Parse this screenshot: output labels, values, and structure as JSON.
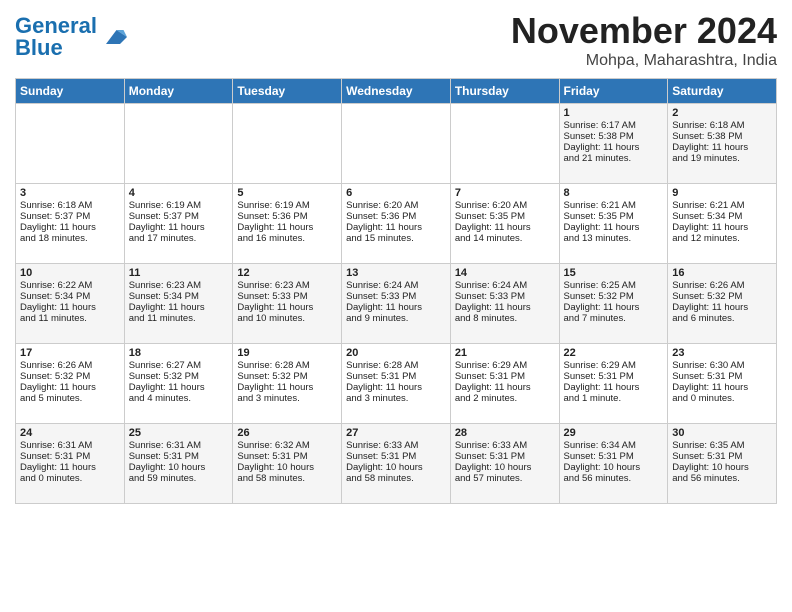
{
  "header": {
    "logo_general": "General",
    "logo_blue": "Blue",
    "month_title": "November 2024",
    "location": "Mohpa, Maharashtra, India"
  },
  "days_of_week": [
    "Sunday",
    "Monday",
    "Tuesday",
    "Wednesday",
    "Thursday",
    "Friday",
    "Saturday"
  ],
  "weeks": [
    [
      {
        "day": "",
        "info": ""
      },
      {
        "day": "",
        "info": ""
      },
      {
        "day": "",
        "info": ""
      },
      {
        "day": "",
        "info": ""
      },
      {
        "day": "",
        "info": ""
      },
      {
        "day": "1",
        "info": "Sunrise: 6:17 AM\nSunset: 5:38 PM\nDaylight: 11 hours\nand 21 minutes."
      },
      {
        "day": "2",
        "info": "Sunrise: 6:18 AM\nSunset: 5:38 PM\nDaylight: 11 hours\nand 19 minutes."
      }
    ],
    [
      {
        "day": "3",
        "info": "Sunrise: 6:18 AM\nSunset: 5:37 PM\nDaylight: 11 hours\nand 18 minutes."
      },
      {
        "day": "4",
        "info": "Sunrise: 6:19 AM\nSunset: 5:37 PM\nDaylight: 11 hours\nand 17 minutes."
      },
      {
        "day": "5",
        "info": "Sunrise: 6:19 AM\nSunset: 5:36 PM\nDaylight: 11 hours\nand 16 minutes."
      },
      {
        "day": "6",
        "info": "Sunrise: 6:20 AM\nSunset: 5:36 PM\nDaylight: 11 hours\nand 15 minutes."
      },
      {
        "day": "7",
        "info": "Sunrise: 6:20 AM\nSunset: 5:35 PM\nDaylight: 11 hours\nand 14 minutes."
      },
      {
        "day": "8",
        "info": "Sunrise: 6:21 AM\nSunset: 5:35 PM\nDaylight: 11 hours\nand 13 minutes."
      },
      {
        "day": "9",
        "info": "Sunrise: 6:21 AM\nSunset: 5:34 PM\nDaylight: 11 hours\nand 12 minutes."
      }
    ],
    [
      {
        "day": "10",
        "info": "Sunrise: 6:22 AM\nSunset: 5:34 PM\nDaylight: 11 hours\nand 11 minutes."
      },
      {
        "day": "11",
        "info": "Sunrise: 6:23 AM\nSunset: 5:34 PM\nDaylight: 11 hours\nand 11 minutes."
      },
      {
        "day": "12",
        "info": "Sunrise: 6:23 AM\nSunset: 5:33 PM\nDaylight: 11 hours\nand 10 minutes."
      },
      {
        "day": "13",
        "info": "Sunrise: 6:24 AM\nSunset: 5:33 PM\nDaylight: 11 hours\nand 9 minutes."
      },
      {
        "day": "14",
        "info": "Sunrise: 6:24 AM\nSunset: 5:33 PM\nDaylight: 11 hours\nand 8 minutes."
      },
      {
        "day": "15",
        "info": "Sunrise: 6:25 AM\nSunset: 5:32 PM\nDaylight: 11 hours\nand 7 minutes."
      },
      {
        "day": "16",
        "info": "Sunrise: 6:26 AM\nSunset: 5:32 PM\nDaylight: 11 hours\nand 6 minutes."
      }
    ],
    [
      {
        "day": "17",
        "info": "Sunrise: 6:26 AM\nSunset: 5:32 PM\nDaylight: 11 hours\nand 5 minutes."
      },
      {
        "day": "18",
        "info": "Sunrise: 6:27 AM\nSunset: 5:32 PM\nDaylight: 11 hours\nand 4 minutes."
      },
      {
        "day": "19",
        "info": "Sunrise: 6:28 AM\nSunset: 5:32 PM\nDaylight: 11 hours\nand 3 minutes."
      },
      {
        "day": "20",
        "info": "Sunrise: 6:28 AM\nSunset: 5:31 PM\nDaylight: 11 hours\nand 3 minutes."
      },
      {
        "day": "21",
        "info": "Sunrise: 6:29 AM\nSunset: 5:31 PM\nDaylight: 11 hours\nand 2 minutes."
      },
      {
        "day": "22",
        "info": "Sunrise: 6:29 AM\nSunset: 5:31 PM\nDaylight: 11 hours\nand 1 minute."
      },
      {
        "day": "23",
        "info": "Sunrise: 6:30 AM\nSunset: 5:31 PM\nDaylight: 11 hours\nand 0 minutes."
      }
    ],
    [
      {
        "day": "24",
        "info": "Sunrise: 6:31 AM\nSunset: 5:31 PM\nDaylight: 11 hours\nand 0 minutes."
      },
      {
        "day": "25",
        "info": "Sunrise: 6:31 AM\nSunset: 5:31 PM\nDaylight: 10 hours\nand 59 minutes."
      },
      {
        "day": "26",
        "info": "Sunrise: 6:32 AM\nSunset: 5:31 PM\nDaylight: 10 hours\nand 58 minutes."
      },
      {
        "day": "27",
        "info": "Sunrise: 6:33 AM\nSunset: 5:31 PM\nDaylight: 10 hours\nand 58 minutes."
      },
      {
        "day": "28",
        "info": "Sunrise: 6:33 AM\nSunset: 5:31 PM\nDaylight: 10 hours\nand 57 minutes."
      },
      {
        "day": "29",
        "info": "Sunrise: 6:34 AM\nSunset: 5:31 PM\nDaylight: 10 hours\nand 56 minutes."
      },
      {
        "day": "30",
        "info": "Sunrise: 6:35 AM\nSunset: 5:31 PM\nDaylight: 10 hours\nand 56 minutes."
      }
    ]
  ]
}
